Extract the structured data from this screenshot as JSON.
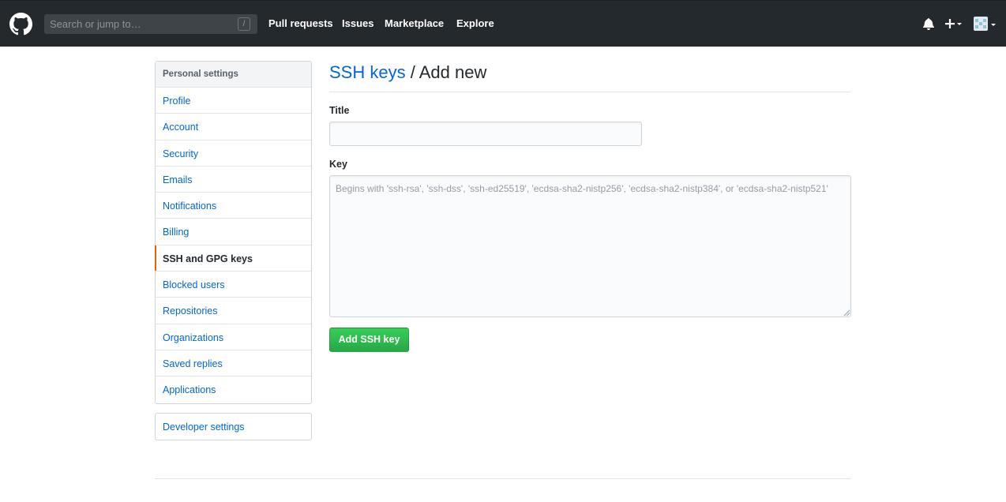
{
  "header": {
    "search_placeholder": "Search or jump to…",
    "search_shortcut": "/",
    "nav": [
      "Pull requests",
      "Issues",
      "Marketplace",
      "Explore"
    ]
  },
  "sidebar": {
    "heading": "Personal settings",
    "items": [
      {
        "label": "Profile"
      },
      {
        "label": "Account"
      },
      {
        "label": "Security"
      },
      {
        "label": "Emails"
      },
      {
        "label": "Notifications"
      },
      {
        "label": "Billing"
      },
      {
        "label": "SSH and GPG keys",
        "selected": true
      },
      {
        "label": "Blocked users"
      },
      {
        "label": "Repositories"
      },
      {
        "label": "Organizations"
      },
      {
        "label": "Saved replies"
      },
      {
        "label": "Applications"
      }
    ],
    "developer_settings": "Developer settings"
  },
  "main": {
    "breadcrumb_link": "SSH keys",
    "breadcrumb_rest": " / Add new",
    "title_label": "Title",
    "title_value": "",
    "key_label": "Key",
    "key_placeholder": "Begins with 'ssh-rsa', 'ssh-dss', 'ssh-ed25519', 'ecdsa-sha2-nistp256', 'ecdsa-sha2-nistp384', or 'ecdsa-sha2-nistp521'",
    "submit_label": "Add SSH key"
  },
  "colors": {
    "header_bg": "#24292e",
    "link": "#0366d6",
    "selected_marker": "#e36209",
    "primary_button": "#28a745"
  },
  "icons": [
    "github-logo-icon",
    "bell-icon",
    "plus-icon",
    "caret-down-icon",
    "avatar-identicon"
  ]
}
